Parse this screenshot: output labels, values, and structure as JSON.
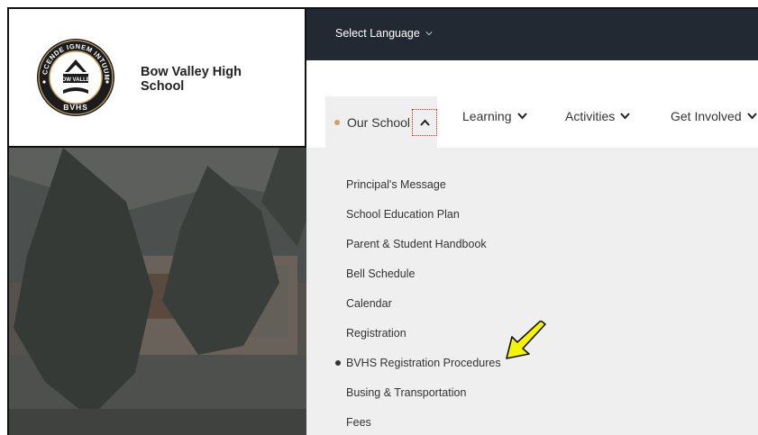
{
  "school": {
    "name": "Bow Valley High School",
    "logo_text_top": "ACCENDE IGNEM INTUUM",
    "logo_banner": "BOW VALLEY",
    "logo_initials": "BVHS"
  },
  "topbar": {
    "language_label": "Select Language"
  },
  "nav": {
    "items": [
      {
        "label": "Our School",
        "state": "expanded"
      },
      {
        "label": "Learning"
      },
      {
        "label": "Activities"
      },
      {
        "label": "Get Involved"
      }
    ]
  },
  "dropdown": {
    "items": [
      {
        "label": "Principal's Message"
      },
      {
        "label": "School Education Plan"
      },
      {
        "label": "Parent & Student Handbook"
      },
      {
        "label": "Bell Schedule"
      },
      {
        "label": "Calendar"
      },
      {
        "label": "Registration"
      },
      {
        "label": "BVHS Registration Procedures",
        "current": true
      },
      {
        "label": "Busing & Transportation"
      },
      {
        "label": "Fees"
      }
    ]
  },
  "colors": {
    "topbar": "#232933",
    "dropdown_bg": "#efefef",
    "accent_gold": "#c9a565",
    "annotation_red": "#d02020",
    "annotation_arrow": "#f5f500"
  }
}
